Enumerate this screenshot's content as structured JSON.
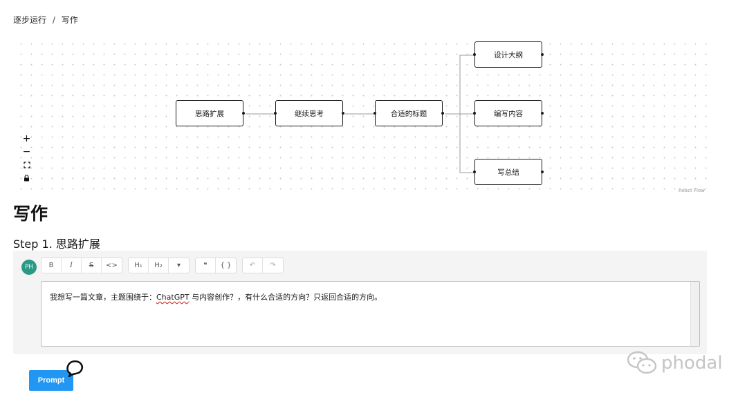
{
  "breadcrumb": {
    "parent": "逐步运行",
    "separator": "/",
    "current": "写作"
  },
  "flow": {
    "nodes": [
      {
        "id": "n1",
        "label": "思路扩展"
      },
      {
        "id": "n2",
        "label": "继续思考"
      },
      {
        "id": "n3",
        "label": "合适的标题"
      },
      {
        "id": "n4",
        "label": "设计大纲"
      },
      {
        "id": "n5",
        "label": "编写内容"
      },
      {
        "id": "n6",
        "label": "写总结"
      }
    ],
    "controls": {
      "zoom_in": "+",
      "zoom_out": "−"
    },
    "attribution": "React Flow"
  },
  "page": {
    "title": "写作",
    "step_title": "Step 1. 思路扩展"
  },
  "editor": {
    "avatar_initials": "PH",
    "avatar_color": "#2a9a85",
    "toolbar": {
      "bold": "B",
      "italic": "I",
      "strike": "S",
      "code": "<>",
      "h1": "H₁",
      "h2": "H₂",
      "more": "▾",
      "quote": "❝",
      "code_block": "{ }",
      "undo": "↶",
      "redo": "↷"
    },
    "content": {
      "before": "我想写一篇文章，主题围绕于：",
      "highlight": "ChatGPT",
      "after": " 与内容创作？，有什么合适的方向？只返回合适的方向。"
    }
  },
  "actions": {
    "prompt_label": "Prompt",
    "prompt_color": "#2196f3"
  },
  "watermark": {
    "text": "phodal"
  },
  "icons": [
    "zoom-in-icon",
    "zoom-out-icon",
    "fit-view-icon",
    "lock-icon",
    "chat-bubble-icon",
    "wechat-icon"
  ]
}
